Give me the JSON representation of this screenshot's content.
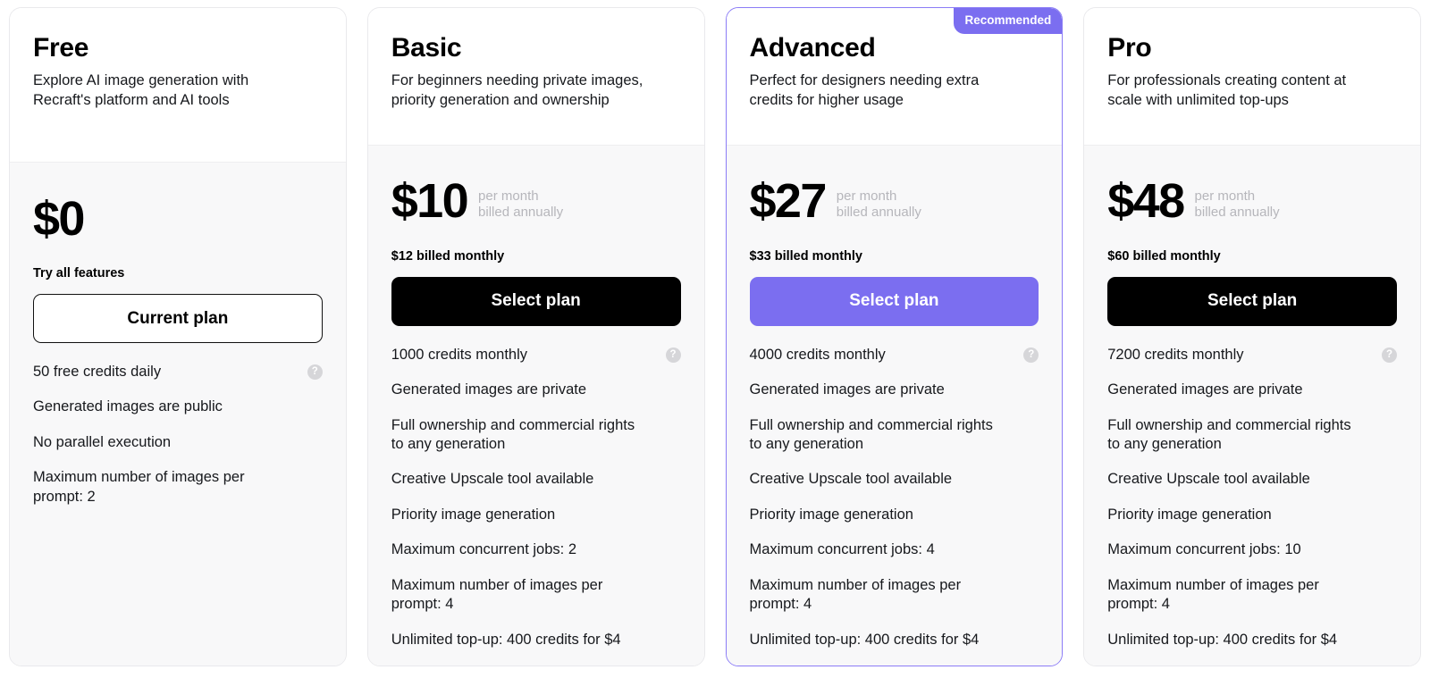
{
  "badge": {
    "recommended_label": "Recommended"
  },
  "icons": {
    "help": "?",
    "help_icon_name": "help-icon"
  },
  "colors": {
    "accent_purple": "#7b6ef0",
    "card_border": "#e9e9ec",
    "recommended_border": "#8b7cf6",
    "body_background": "#f8f8f9",
    "help_icon": "#d6d6d9",
    "muted_text": "#b6b6bb"
  },
  "plans": [
    {
      "name": "Free",
      "tagline": "Explore AI image generation with Recraft's platform and AI tools",
      "price": "$0",
      "period": "",
      "billing_note": "Try all features",
      "cta_label": "Current plan",
      "cta_style": "outline",
      "recommended": false,
      "features": [
        {
          "text": "50 free credits daily",
          "help": true
        },
        {
          "text": "Generated images are public",
          "help": false
        },
        {
          "text": "No parallel execution",
          "help": false
        },
        {
          "text": "Maximum number of images per prompt: 2",
          "help": false
        }
      ]
    },
    {
      "name": "Basic",
      "tagline": "For beginners needing private images, priority generation and ownership",
      "price": "$10",
      "period": "per month\nbilled annually",
      "billing_note": "$12 billed monthly",
      "cta_label": "Select plan",
      "cta_style": "dark",
      "recommended": false,
      "features": [
        {
          "text": "1000 credits monthly",
          "help": true
        },
        {
          "text": "Generated images are private",
          "help": false
        },
        {
          "text": "Full ownership and commercial rights to any generation",
          "help": false
        },
        {
          "text": "Creative Upscale tool available",
          "help": false
        },
        {
          "text": "Priority image generation",
          "help": false
        },
        {
          "text": "Maximum concurrent jobs: 2",
          "help": false
        },
        {
          "text": "Maximum number of images per prompt: 4",
          "help": false
        },
        {
          "text": "Unlimited top-up: 400 credits for $4",
          "help": false
        }
      ]
    },
    {
      "name": "Advanced",
      "tagline": "Perfect for designers needing extra credits for higher usage",
      "price": "$27",
      "period": "per month\nbilled annually",
      "billing_note": "$33 billed monthly",
      "cta_label": "Select plan",
      "cta_style": "purple",
      "recommended": true,
      "features": [
        {
          "text": "4000 credits monthly",
          "help": true
        },
        {
          "text": "Generated images are private",
          "help": false
        },
        {
          "text": "Full ownership and commercial rights to any generation",
          "help": false
        },
        {
          "text": "Creative Upscale tool available",
          "help": false
        },
        {
          "text": "Priority image generation",
          "help": false
        },
        {
          "text": "Maximum concurrent jobs: 4",
          "help": false
        },
        {
          "text": "Maximum number of images per prompt: 4",
          "help": false
        },
        {
          "text": "Unlimited top-up: 400 credits for $4",
          "help": false
        }
      ]
    },
    {
      "name": "Pro",
      "tagline": "For professionals creating content at scale with unlimited top-ups",
      "price": "$48",
      "period": "per month\nbilled annually",
      "billing_note": "$60 billed monthly",
      "cta_label": "Select plan",
      "cta_style": "dark",
      "recommended": false,
      "features": [
        {
          "text": "7200 credits monthly",
          "help": true
        },
        {
          "text": "Generated images are private",
          "help": false
        },
        {
          "text": "Full ownership and commercial rights to any generation",
          "help": false
        },
        {
          "text": "Creative Upscale tool available",
          "help": false
        },
        {
          "text": "Priority image generation",
          "help": false
        },
        {
          "text": "Maximum concurrent jobs: 10",
          "help": false
        },
        {
          "text": "Maximum number of images per prompt: 4",
          "help": false
        },
        {
          "text": "Unlimited top-up: 400 credits for $4",
          "help": false
        }
      ]
    }
  ]
}
